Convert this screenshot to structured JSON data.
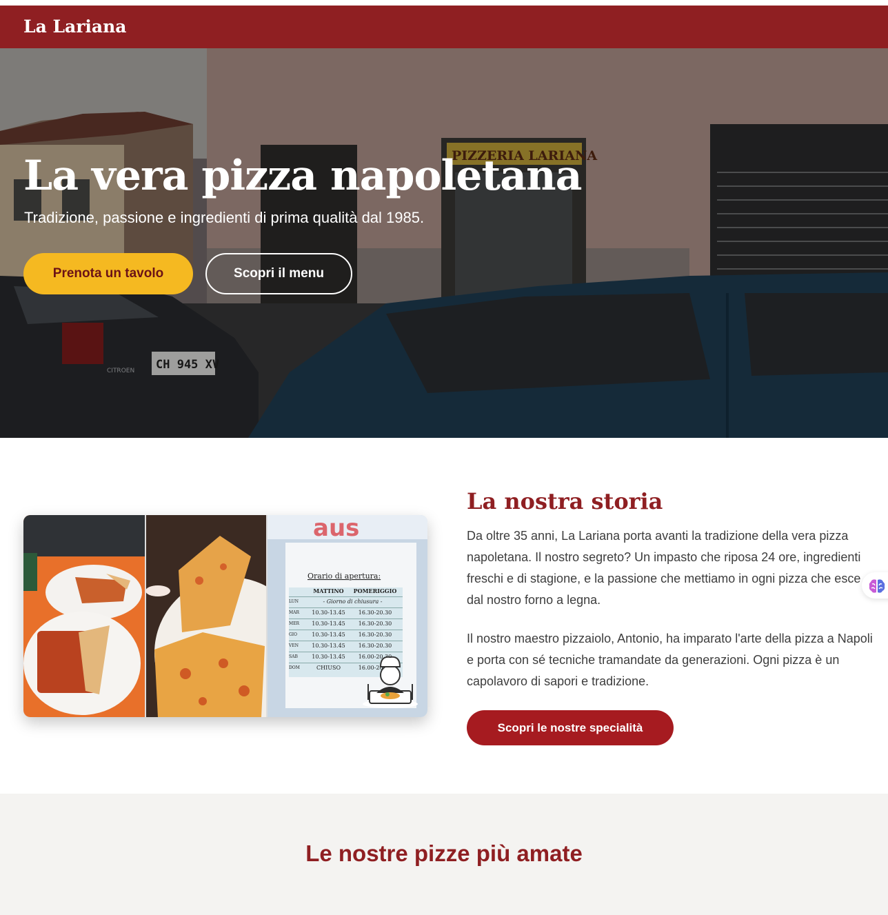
{
  "header": {
    "brand": "La Lariana"
  },
  "hero": {
    "title": "La vera pizza napoletana",
    "subtitle": "Tradizione, passione e ingredienti di prima qualità dal 1985.",
    "primary_button": "Prenota un tavolo",
    "secondary_button": "Scopri il menu",
    "photo": {
      "sign_text": "PIZZERIA LARIANA",
      "plate_text": "CH 945 XV",
      "car_brand": "CITROEN"
    }
  },
  "story": {
    "title": "La nostra storia",
    "paragraphs": [
      "Da oltre 35 anni, La Lariana porta avanti la tradizione della vera pizza napoletana. Il nostro segreto? Un impasto che riposa 24 ore, ingredienti freschi e di stagione, e la passione che mettiamo in ogni pizza che esce dal nostro forno a legna.",
      "Il nostro maestro pizzaiolo, Antonio, ha imparato l'arte della pizza a Napoli e porta con sé tecniche tramandate da generazioni. Ogni pizza è un capolavoro di sapori e tradizione."
    ],
    "button": "Scopri le nostre specialità",
    "collage": {
      "sign_title": "Orario di apertura:",
      "col_morning": "MATTINO",
      "col_afternoon": "POMERIGGIO",
      "closed_note": "- Giorno di chiusura -",
      "rows": [
        {
          "day": "LUN",
          "morning": "",
          "afternoon": ""
        },
        {
          "day": "MAR",
          "morning": "10.30-13.45",
          "afternoon": "16.30-20.30"
        },
        {
          "day": "MER",
          "morning": "10.30-13.45",
          "afternoon": "16.30-20.30"
        },
        {
          "day": "GIO",
          "morning": "10.30-13.45",
          "afternoon": "16.30-20.30"
        },
        {
          "day": "VEN",
          "morning": "10.30-13.45",
          "afternoon": "16.30-20.30"
        },
        {
          "day": "SAB",
          "morning": "10.30-13.45",
          "afternoon": "16.00-20.30"
        },
        {
          "day": "DOM",
          "morning": "CHIUSO",
          "afternoon": "16.00-20.30"
        }
      ]
    }
  },
  "favorites": {
    "title": "Le nostre pizze più amate"
  },
  "icons": {
    "ai_widget": "brain-icon",
    "chef": "chef-icon"
  },
  "colors": {
    "brand_red": "#8f1f22",
    "button_red": "#a61b20",
    "accent_yellow": "#f5b921"
  }
}
